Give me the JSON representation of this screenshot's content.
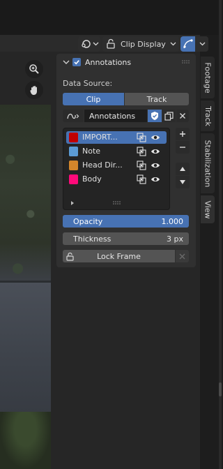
{
  "header": {
    "clip_display_label": "Clip Display"
  },
  "panel": {
    "title": "Annotations",
    "enabled": true,
    "data_source_label": "Data Source:",
    "source_options": [
      "Clip",
      "Track"
    ],
    "selected_source": "Clip",
    "datablock_name": "Annotations",
    "layers": [
      {
        "name": "IMPORT...",
        "color": "#c00000",
        "active": true
      },
      {
        "name": "Note",
        "color": "#5b9bd5",
        "active": false
      },
      {
        "name": "Head Dir...",
        "color": "#d4862b",
        "active": false
      },
      {
        "name": "Body",
        "color": "#ff0a7a",
        "active": false
      }
    ],
    "opacity_label": "Opacity",
    "opacity_value": "1.000",
    "thickness_label": "Thickness",
    "thickness_value": "3 px",
    "lock_frame_label": "Lock Frame"
  },
  "tabs": [
    "Footage",
    "Track",
    "Stabilization",
    "View"
  ],
  "active_tab": "View",
  "colors": {
    "accent": "#4772b3",
    "panel_bg": "#303030",
    "field_bg": "#545454"
  },
  "icons": [
    "gizmo-icon",
    "lock-icon",
    "curve-icon",
    "chevron-down-icon",
    "zoom-icon",
    "hand-icon",
    "shield-icon",
    "copy-icon",
    "close-icon",
    "eye-icon",
    "onion-skin-icon",
    "plus-icon",
    "minus-icon",
    "arrow-up-icon",
    "arrow-down-icon",
    "grip-icon",
    "expand-arrow-icon"
  ]
}
